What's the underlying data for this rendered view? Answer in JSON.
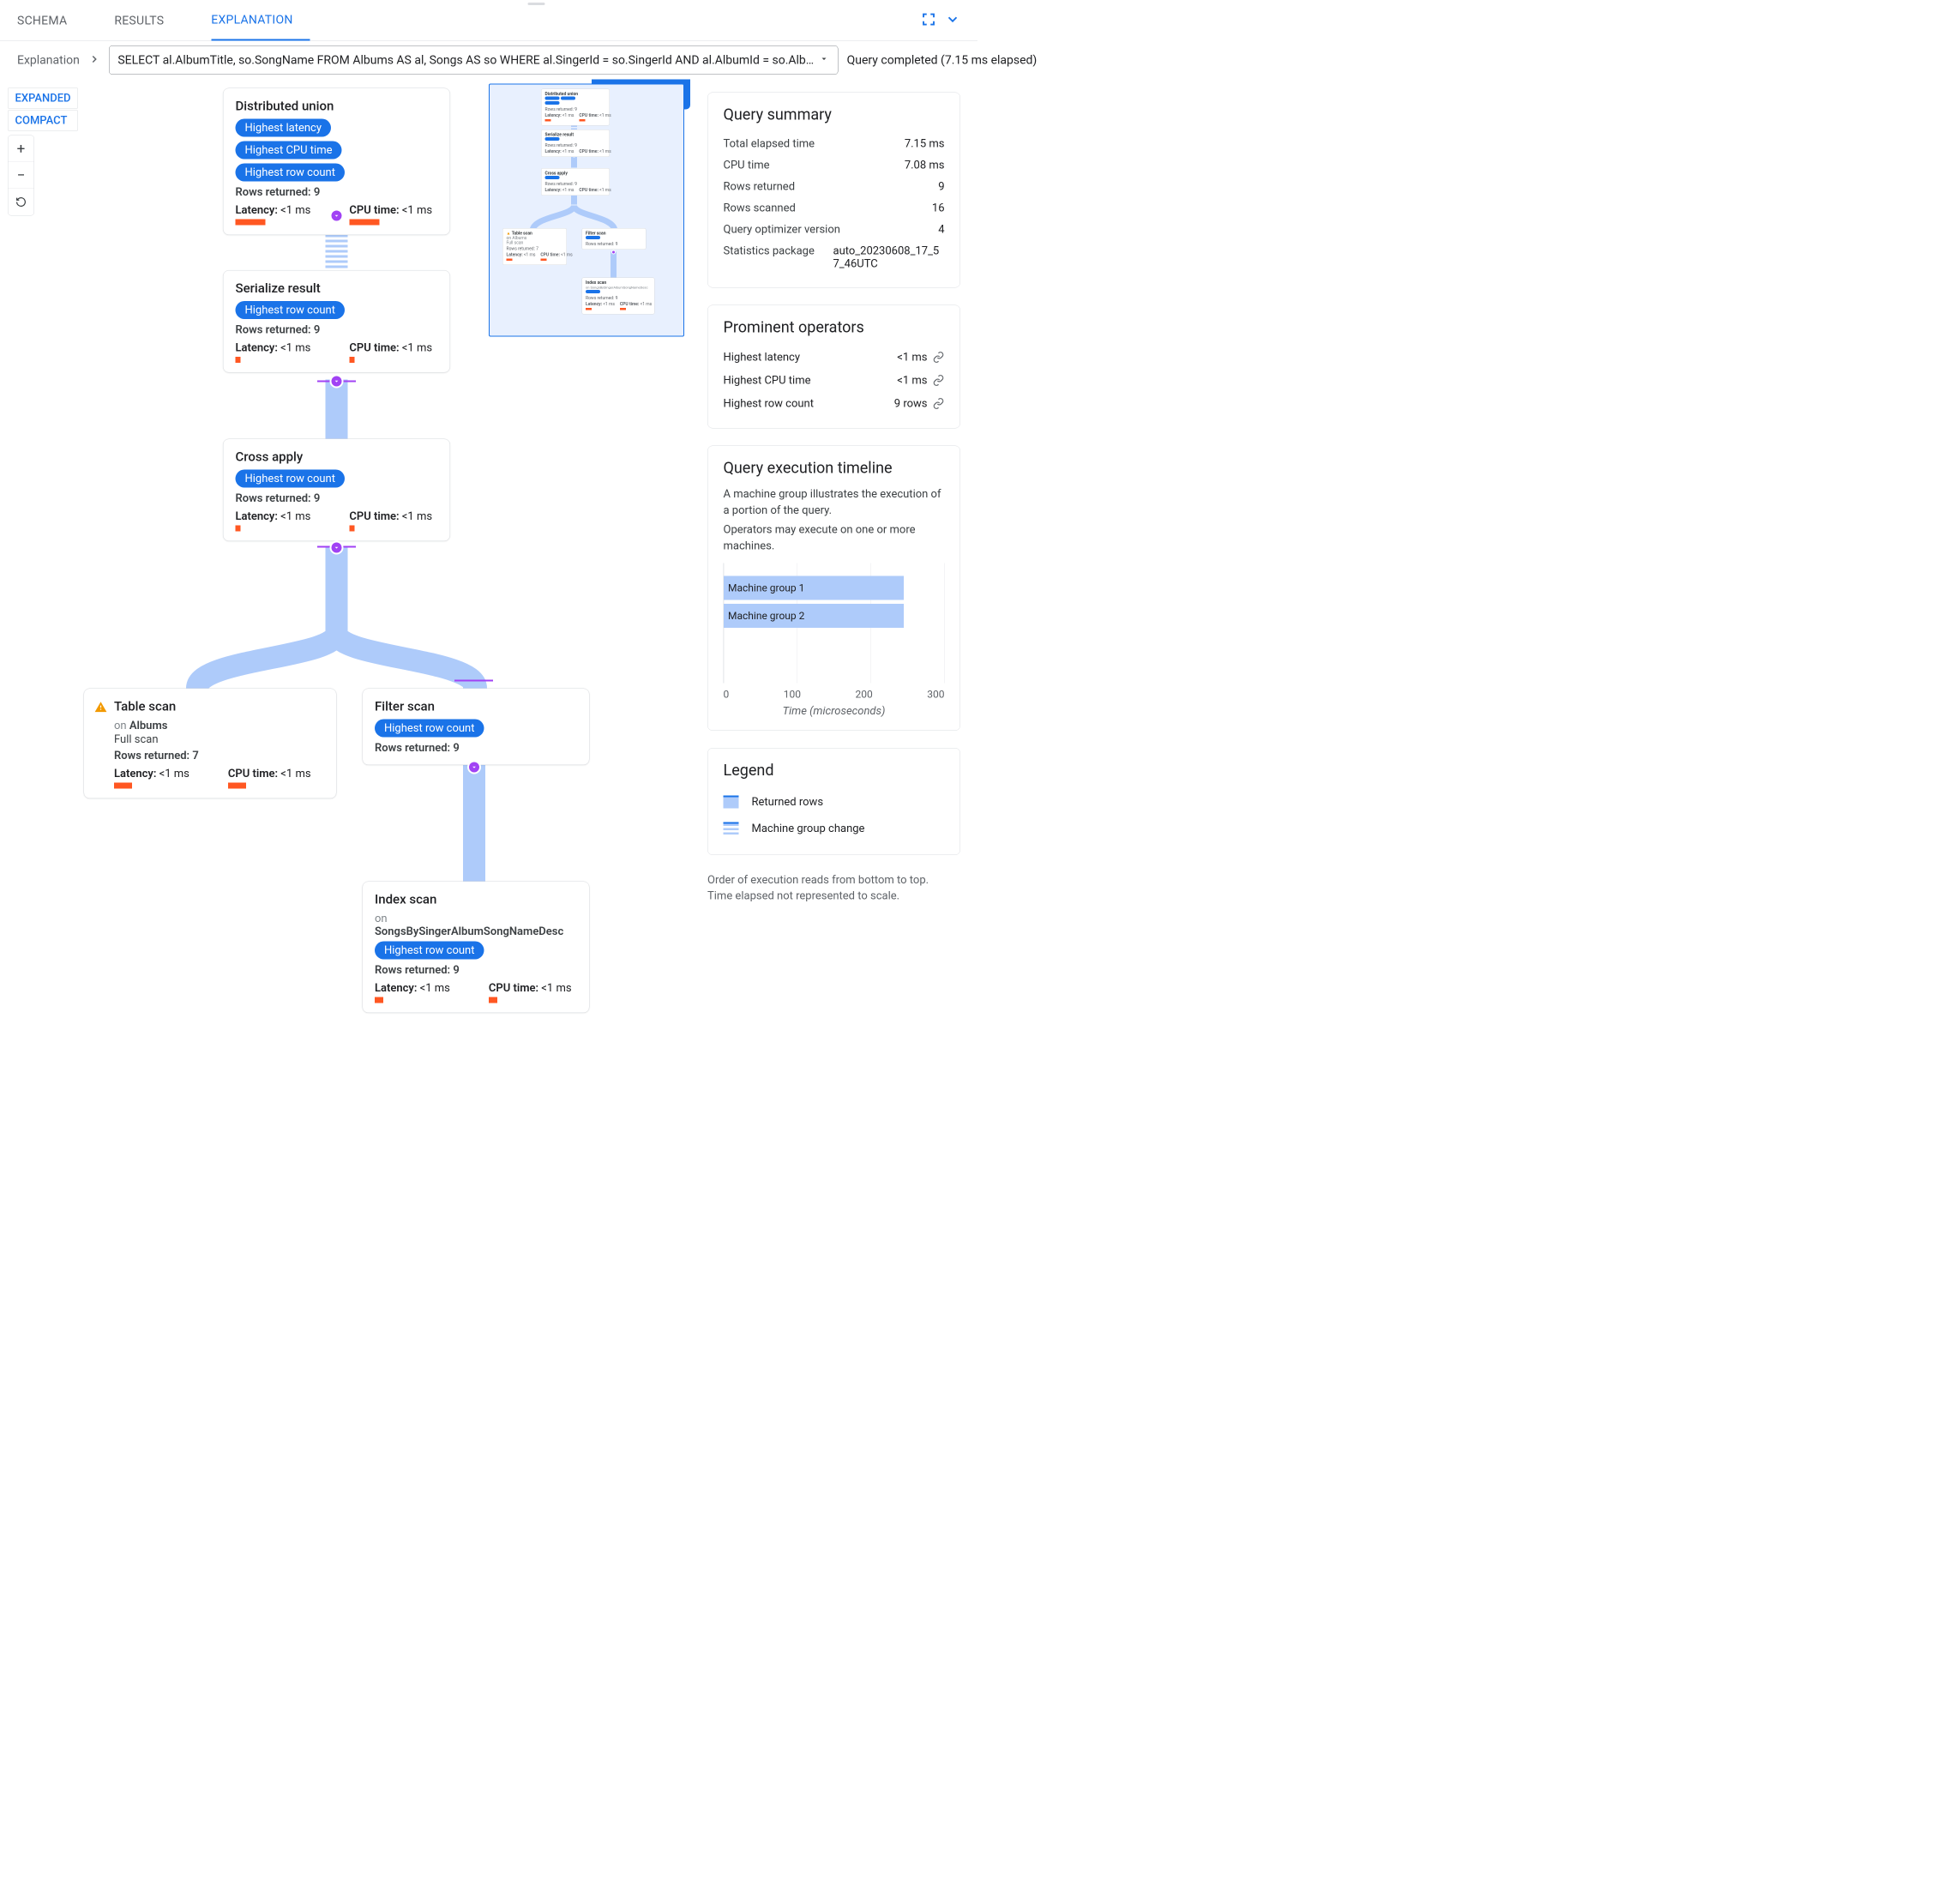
{
  "tabs": {
    "schema": "SCHEMA",
    "results": "RESULTS",
    "explanation": "EXPLANATION"
  },
  "breadcrumb": "Explanation",
  "query_text": "SELECT al.AlbumTitle, so.SongName FROM Albums AS al, Songs AS so WHERE al.SingerId = so.SingerId AND al.AlbumId = so.Alb…",
  "query_status": "Query completed (7.15 ms elapsed)",
  "view_modes": {
    "expanded": "EXPANDED",
    "compact": "COMPACT"
  },
  "nodes": {
    "distributed_union": {
      "title": "Distributed union",
      "pill_latency": "Highest latency",
      "pill_cpu": "Highest CPU time",
      "pill_rows": "Highest row count",
      "rows": "Rows returned: 9",
      "latency_lbl": "Latency:",
      "latency_val": " <1 ms",
      "cpu_lbl": "CPU time:",
      "cpu_val": " <1 ms"
    },
    "serialize": {
      "title": "Serialize result",
      "pill_rows": "Highest row count",
      "rows": "Rows returned: 9",
      "latency_lbl": "Latency:",
      "latency_val": " <1 ms",
      "cpu_lbl": "CPU time:",
      "cpu_val": " <1 ms"
    },
    "cross_apply": {
      "title": "Cross apply",
      "pill_rows": "Highest row count",
      "rows": "Rows returned: 9",
      "latency_lbl": "Latency:",
      "latency_val": " <1 ms",
      "cpu_lbl": "CPU time:",
      "cpu_val": " <1 ms"
    },
    "table_scan": {
      "title": "Table scan",
      "on_prefix": "on ",
      "on_target": "Albums",
      "note": "Full scan",
      "rows": "Rows returned: 7",
      "latency_lbl": "Latency:",
      "latency_val": " <1 ms",
      "cpu_lbl": "CPU time:",
      "cpu_val": " <1 ms"
    },
    "filter_scan": {
      "title": "Filter scan",
      "pill_rows": "Highest row count",
      "rows": "Rows returned: 9"
    },
    "index_scan": {
      "title": "Index scan",
      "on_prefix": "on ",
      "on_target": "SongsBySingerAlbumSongNameDesc",
      "pill_rows": "Highest row count",
      "rows": "Rows returned: 9",
      "latency_lbl": "Latency:",
      "latency_val": " <1 ms",
      "cpu_lbl": "CPU time:",
      "cpu_val": " <1 ms"
    }
  },
  "summary": {
    "heading": "Query summary",
    "rows": {
      "elapsed_k": "Total elapsed time",
      "elapsed_v": "7.15 ms",
      "cpu_k": "CPU time",
      "cpu_v": "7.08 ms",
      "returned_k": "Rows returned",
      "returned_v": "9",
      "scanned_k": "Rows scanned",
      "scanned_v": "16",
      "optimizer_k": "Query optimizer version",
      "optimizer_v": "4",
      "stats_k": "Statistics package",
      "stats_v": "auto_20230608_17_57_46UTC"
    }
  },
  "prominent": {
    "heading": "Prominent operators",
    "latency_k": "Highest latency",
    "latency_v": "<1 ms",
    "cpu_k": "Highest CPU time",
    "cpu_v": "<1 ms",
    "rows_k": "Highest row count",
    "rows_v": "9 rows"
  },
  "timeline": {
    "heading": "Query execution timeline",
    "desc1": "A machine group illustrates the execution of a portion of the query.",
    "desc2": "Operators may execute on one or more machines.",
    "xlabel": "Time (microseconds)",
    "group1": "Machine group 1",
    "group2": "Machine group 2"
  },
  "legend": {
    "heading": "Legend",
    "rows_label": "Returned rows",
    "change_label": "Machine group change"
  },
  "footer_note1": "Order of execution reads from bottom to top.",
  "footer_note2": "Time elapsed not represented to scale.",
  "chart_data": {
    "type": "bar",
    "orientation": "horizontal",
    "title": "Query execution timeline",
    "xlabel": "Time (microseconds)",
    "ylabel": "",
    "xlim": [
      0,
      300
    ],
    "ticks": [
      0,
      100,
      200,
      300
    ],
    "categories": [
      "Machine group 1",
      "Machine group 2"
    ],
    "values": [
      245,
      245
    ]
  }
}
